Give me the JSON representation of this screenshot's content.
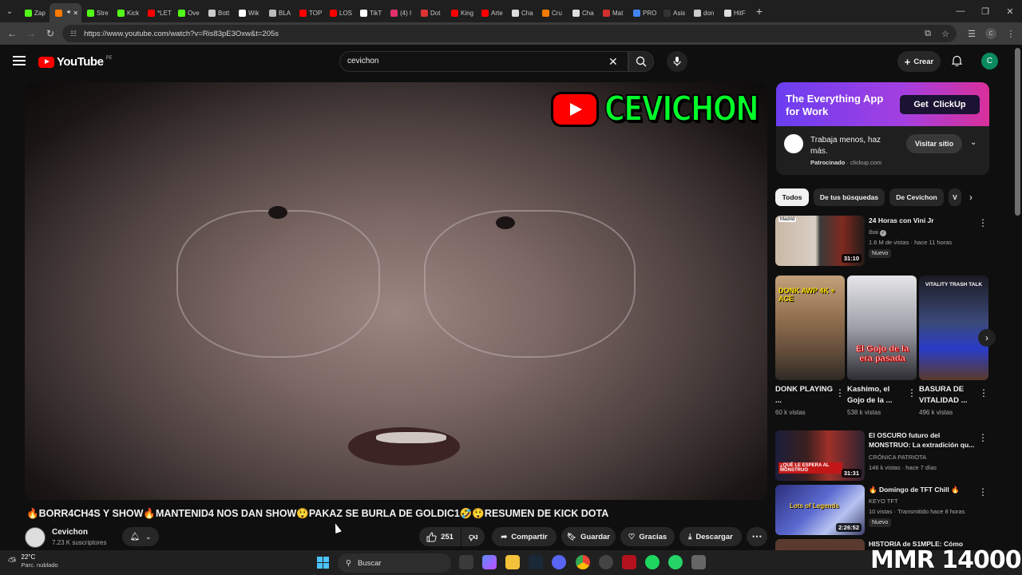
{
  "browser": {
    "tabs": [
      {
        "label": "Zap",
        "color": "#53fc18"
      },
      {
        "label": "",
        "color": "#ff7a00"
      },
      {
        "label": "Stre",
        "color": "#53fc18"
      },
      {
        "label": "Kick",
        "color": "#53fc18"
      },
      {
        "label": "*LET",
        "color": "#ff0000"
      },
      {
        "label": "Ove",
        "color": "#53fc18"
      },
      {
        "label": "Bott",
        "color": "#cccccc"
      },
      {
        "label": "Wik",
        "color": "#ffffff"
      },
      {
        "label": "BLA",
        "color": "#bbbbbb"
      },
      {
        "label": "TOP",
        "color": "#ff0000"
      },
      {
        "label": "LOS",
        "color": "#ff0000"
      },
      {
        "label": "TikT",
        "color": "#ffffff"
      },
      {
        "label": "(4) I",
        "color": "#e1306c"
      },
      {
        "label": "Dot",
        "color": "#d33"
      },
      {
        "label": "King",
        "color": "#ff0000"
      },
      {
        "label": "Arte",
        "color": "#ff0000"
      },
      {
        "label": "Cha",
        "color": "#dddddd"
      },
      {
        "label": "Cru",
        "color": "#f57c00"
      },
      {
        "label": "Cha",
        "color": "#dddddd"
      },
      {
        "label": "Mat",
        "color": "#d32f2f"
      },
      {
        "label": "PRO",
        "color": "#4285f4"
      },
      {
        "label": "Asis",
        "color": "#333333"
      },
      {
        "label": "don",
        "color": "#cccccc"
      },
      {
        "label": "HitF",
        "color": "#dddddd"
      }
    ],
    "active_tab_index": 1,
    "url": "https://www.youtube.com/watch?v=Ris83pE3Oxw&t=205s",
    "profile_letter": "C"
  },
  "youtube": {
    "logo_text": "YouTube",
    "country_code": "PE",
    "search_value": "cevichon",
    "create_label": "Crear",
    "avatar_letter": "C"
  },
  "video": {
    "overlay_text": "CEVICHON",
    "title": "🔥BORR4CH4S Y SHOW🔥MANTENID4 NOS DAN SHOW😲PAKAZ SE BURLA DE GOLDIC1🤣😲RESUMEN DE KICK DOTA",
    "channel": "Cevichon",
    "subscribers": "7.23 K suscriptores",
    "likes": "251",
    "share_label": "Compartir",
    "save_label": "Guardar",
    "thanks_label": "Gracias",
    "download_label": "Descargar"
  },
  "ad": {
    "banner_line1": "The Everything App",
    "banner_line2": "for Work",
    "get_label": "Get",
    "brand": "ClickUp",
    "description": "Trabaja menos, haz más.",
    "sponsored": "Patrocinado",
    "domain": "clickup.com",
    "visit_label": "Visitar sitio"
  },
  "chips": [
    "Todos",
    "De tus búsquedas",
    "De Cevichon",
    "V"
  ],
  "recommendations": [
    {
      "title": "24 Horas con Vini Jr",
      "channel": "Ibai",
      "verified": true,
      "meta": "1.6 M de vistas · hace 11 horas",
      "duration": "31:10",
      "badge": "Nuevo",
      "corner_label": "Madrid"
    },
    {
      "title": "El OSCURO futuro del MONSTRUO: La extradición qu...",
      "channel": "CRÓNICA PATRIOTA",
      "meta": "146 k vistas · hace 7 días",
      "duration": "31:31",
      "thumb_text": "¿QUÉ LE ESPERA AL MONSTRUO"
    },
    {
      "title": "🔥 Domingo de TFT Chill 🔥",
      "channel": "KEYO TFT",
      "meta": "10 vistas · Transmitido hace 8 horas",
      "duration": "2:26:52",
      "badge": "Nuevo",
      "thumb_text": "Lots of Legends"
    },
    {
      "title": "HISTORIA de S1MPLE: Cómo",
      "channel": "",
      "meta": "",
      "duration": ""
    }
  ],
  "shorts": [
    {
      "title": "DONK PLAYING ...",
      "views": "60 k vistas",
      "thumb_text": "DONK AWP 4K + ACE"
    },
    {
      "title": "Kashimo, el Gojo de la ...",
      "views": "538 k vistas",
      "thumb_text": "El Gojo de la era pasada"
    },
    {
      "title": "BASURA DE VITALIDAD ...",
      "views": "496 k vistas",
      "thumb_text": "VITALITY TRASH TALK"
    }
  ],
  "taskbar": {
    "temperature": "22°C",
    "condition": "Parc. nublado",
    "search_label": "Buscar"
  },
  "stream_overlay": "MMR 14000",
  "icons": [
    "menu-icon",
    "search-icon",
    "mic-icon",
    "plus-icon",
    "bell-icon",
    "like-icon",
    "dislike-icon",
    "share-icon",
    "save-icon",
    "thanks-icon",
    "download-icon",
    "more-icon",
    "chevron-right-icon",
    "windows-icon"
  ]
}
